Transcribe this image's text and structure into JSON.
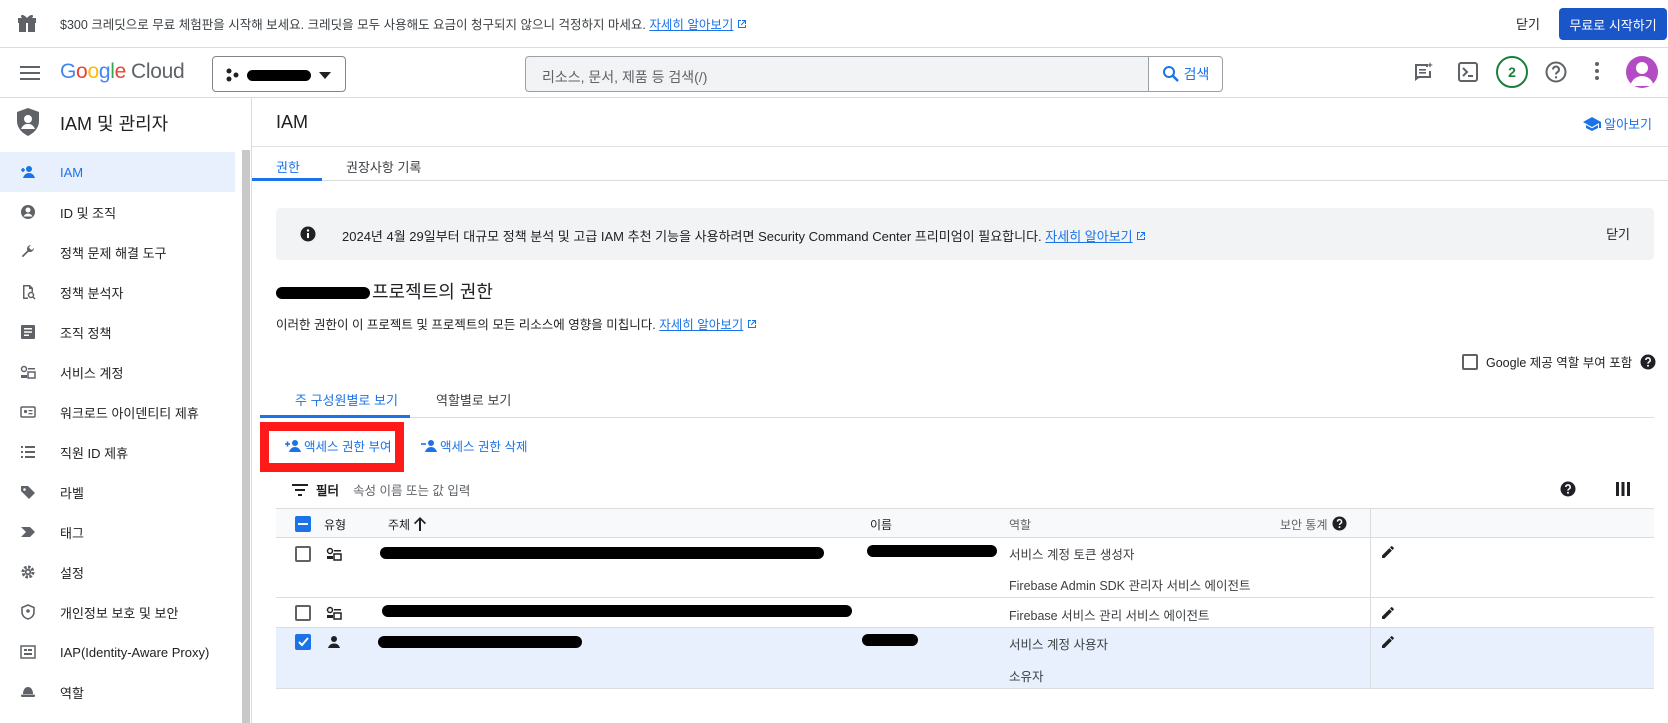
{
  "promo": {
    "message": "$300 크레딧으로 무료 체험판을 시작해 보세요. 크레딧을 모두 사용해도 요금이 청구되지 않으니 걱정하지 마세요.",
    "link": "자세히 알아보기",
    "close": "닫기",
    "start": "무료로 시작하기"
  },
  "header": {
    "logo_google": [
      "G",
      "o",
      "o",
      "g",
      "l",
      "e"
    ],
    "logo_cloud": "Cloud",
    "search_placeholder": "리소스, 문서, 제품 등 검색(/)",
    "search_button": "검색",
    "notifications_count": "2"
  },
  "sidebar": {
    "title": "IAM 및 관리자",
    "items": [
      {
        "label": "IAM",
        "icon": "person-add-icon",
        "active": true
      },
      {
        "label": "ID 및 조직",
        "icon": "account-circle-icon"
      },
      {
        "label": "정책 문제 해결 도구",
        "icon": "wrench-icon"
      },
      {
        "label": "정책 분석자",
        "icon": "document-search-icon"
      },
      {
        "label": "조직 정책",
        "icon": "article-icon"
      },
      {
        "label": "서비스 계정",
        "icon": "service-account-icon"
      },
      {
        "label": "워크로드 아이덴티티 제휴",
        "icon": "id-card-icon"
      },
      {
        "label": "직원 ID 제휴",
        "icon": "list-icon"
      },
      {
        "label": "라벨",
        "icon": "label-icon"
      },
      {
        "label": "태그",
        "icon": "tag-icon"
      },
      {
        "label": "설정",
        "icon": "gear-icon"
      },
      {
        "label": "개인정보 보호 및 보안",
        "icon": "shield-icon"
      },
      {
        "label": "IAP(Identity-Aware Proxy)",
        "icon": "proxy-icon"
      },
      {
        "label": "역할",
        "icon": "hat-icon"
      }
    ]
  },
  "main": {
    "title": "IAM",
    "learn": "알아보기",
    "tabs": [
      "권한",
      "권장사항 기록"
    ],
    "banner": {
      "text": "2024년 4월 29일부터 대규모 정책 분석 및 고급 IAM 추천 기능을 사용하려면 Security Command Center 프리미엄이 필요합니다.",
      "link": "자세히 알아보기",
      "close": "닫기"
    },
    "perm_title": "프로젝트의 권한",
    "perm_desc": "이러한 권한이 이 프로젝트 및 프로젝트의 모든 리소스에 영향을 미칩니다.",
    "perm_link": "자세히 알아보기",
    "google_roles_checkbox": "Google 제공 역할 부여 포함",
    "view_tabs": [
      "주 구성원별로 보기",
      "역할별로 보기"
    ],
    "grant_access": "액세스 권한 부여",
    "remove_access": "액세스 권한 삭제",
    "filter_label": "필터",
    "filter_placeholder": "속성 이름 또는 값 입력"
  },
  "table": {
    "columns": [
      "유형",
      "주체",
      "이름",
      "역할",
      "보안 통계"
    ],
    "rows": [
      {
        "roles": [
          "서비스 계정 토큰 생성자",
          "Firebase Admin SDK 관리자 서비스 에이전트"
        ],
        "checked": false
      },
      {
        "roles": [
          "Firebase 서비스 관리 서비스 에이전트"
        ],
        "checked": false
      },
      {
        "roles": [
          "서비스 계정 사용자",
          "소유자"
        ],
        "checked": true
      }
    ]
  },
  "colors": {
    "accent": "#1a73e8",
    "primary_button": "#1a56c9",
    "highlight_box": "#ff1a1a",
    "selected_row": "#e8f0fe"
  }
}
